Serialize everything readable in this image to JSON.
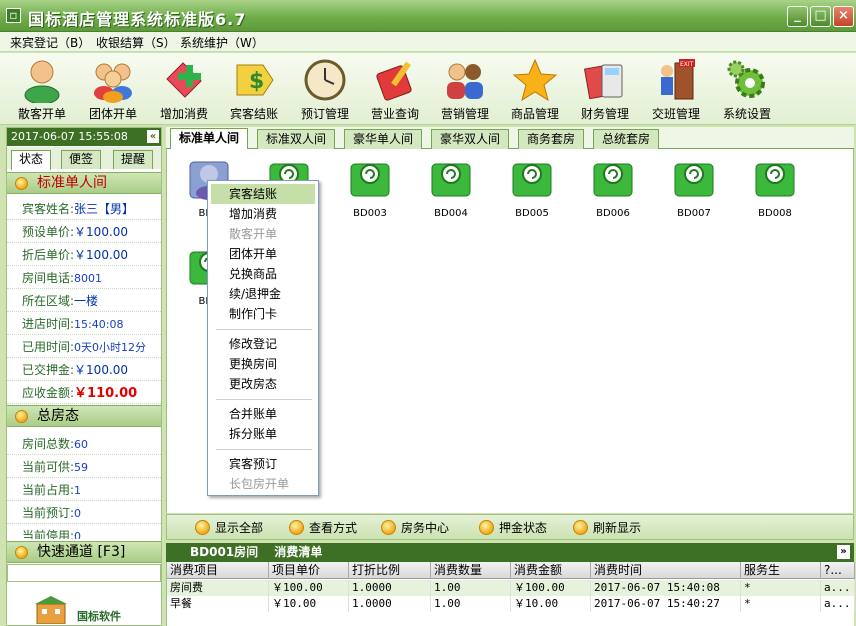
{
  "window": {
    "title": "国标酒店管理系统标准版6.7",
    "min": "_",
    "max": "□",
    "close": "×"
  },
  "menu": [
    "来宾登记（B）",
    "收银结算（S）",
    "系统维护（W）"
  ],
  "toolbar": [
    {
      "label": "散客开单",
      "icon": "person-icon"
    },
    {
      "label": "团体开单",
      "icon": "group-icon"
    },
    {
      "label": "增加消费",
      "icon": "add-consumption-icon"
    },
    {
      "label": "宾客结账",
      "icon": "checkout-icon"
    },
    {
      "label": "预订管理",
      "icon": "clock-icon"
    },
    {
      "label": "营业查询",
      "icon": "query-icon"
    },
    {
      "label": "营销管理",
      "icon": "marketing-icon"
    },
    {
      "label": "商品管理",
      "icon": "star-icon"
    },
    {
      "label": "财务管理",
      "icon": "calculator-icon"
    },
    {
      "label": "交班管理",
      "icon": "exit-icon"
    },
    {
      "label": "系统设置",
      "icon": "gear-icon"
    }
  ],
  "left": {
    "datetime": "2017-06-07 15:55:08",
    "collapse": "«",
    "tabs": [
      "状态",
      "便签",
      "提醒"
    ],
    "room_section": "标准单人间",
    "room_info": [
      {
        "label": "宾客姓名:",
        "value": "张三【男】"
      },
      {
        "label": "预设单价:",
        "value": "￥100.00"
      },
      {
        "label": "折后单价:",
        "value": "￥100.00"
      },
      {
        "label": "房间电话:",
        "value": "8001"
      },
      {
        "label": "所在区域:",
        "value": "一楼"
      },
      {
        "label": "进店时间:",
        "value": "15:40:08"
      },
      {
        "label": "已用时间:",
        "value": "0天0小时12分"
      },
      {
        "label": "已交押金:",
        "value": "￥100.00"
      },
      {
        "label": "应收金额:",
        "value": "￥110.00"
      }
    ],
    "status_section": "总房态",
    "status_info": [
      {
        "label": "房间总数:",
        "value": "60"
      },
      {
        "label": "当前可供:",
        "value": "59"
      },
      {
        "label": "当前占用:",
        "value": "1"
      },
      {
        "label": "当前预订:",
        "value": "0"
      },
      {
        "label": "当前停用:",
        "value": "0"
      }
    ],
    "quick_channel": "快速通道 [F3]",
    "logo_text": "国标软件"
  },
  "room_tabs": [
    "标准单人间",
    "标准双人间",
    "豪华单人间",
    "豪华双人间",
    "商务套房",
    "总统套房"
  ],
  "rooms": [
    {
      "id": "BD001",
      "label": "BD0",
      "occupied": true
    },
    {
      "id": "BD002",
      "label": "",
      "occupied": false
    },
    {
      "id": "BD003",
      "label": "BD003",
      "occupied": false
    },
    {
      "id": "BD004",
      "label": "BD004",
      "occupied": false
    },
    {
      "id": "BD005",
      "label": "BD005",
      "occupied": false
    },
    {
      "id": "BD006",
      "label": "BD006",
      "occupied": false
    },
    {
      "id": "BD007",
      "label": "BD007",
      "occupied": false
    },
    {
      "id": "BD008",
      "label": "BD008",
      "occupied": false
    },
    {
      "id": "BD009",
      "label": "BD0",
      "occupied": false
    }
  ],
  "context_menu": [
    {
      "label": "宾客结账",
      "state": "highlight"
    },
    {
      "label": "增加消费",
      "state": ""
    },
    {
      "label": "散客开单",
      "state": "disabled"
    },
    {
      "label": "团体开单",
      "state": ""
    },
    {
      "label": "兑换商品",
      "state": ""
    },
    {
      "label": "续/退押金",
      "state": ""
    },
    {
      "label": "制作门卡",
      "state": ""
    },
    {
      "label": "修改登记",
      "state": ""
    },
    {
      "label": "更换房间",
      "state": ""
    },
    {
      "label": "更改房态",
      "state": ""
    },
    {
      "label": "合并账单",
      "state": ""
    },
    {
      "label": "拆分账单",
      "state": ""
    },
    {
      "label": "宾客预订",
      "state": ""
    },
    {
      "label": "长包房开单",
      "state": "disabled"
    }
  ],
  "actions": [
    "显示全部",
    "查看方式",
    "房务中心",
    "押金状态",
    "刷新显示"
  ],
  "bill": {
    "room": "BD001房间",
    "title": "消费清单",
    "expand": "»",
    "columns": [
      "消费项目",
      "项目单价",
      "打折比例",
      "消费数量",
      "消费金额",
      "消费时间",
      "服务生",
      "?..."
    ],
    "rows": [
      [
        "房间费",
        "￥100.00",
        "1.0000",
        "1.00",
        "￥100.00",
        "2017-06-07 15:40:08",
        "*",
        "a..."
      ],
      [
        "早餐",
        "￥10.00",
        "1.0000",
        "1.00",
        "￥10.00",
        "2017-06-07 15:40:27",
        "*",
        "a..."
      ]
    ]
  },
  "colors": {
    "accent": "#3d6f24",
    "amount": "#e00000",
    "highlight": "#c6dfa8"
  }
}
